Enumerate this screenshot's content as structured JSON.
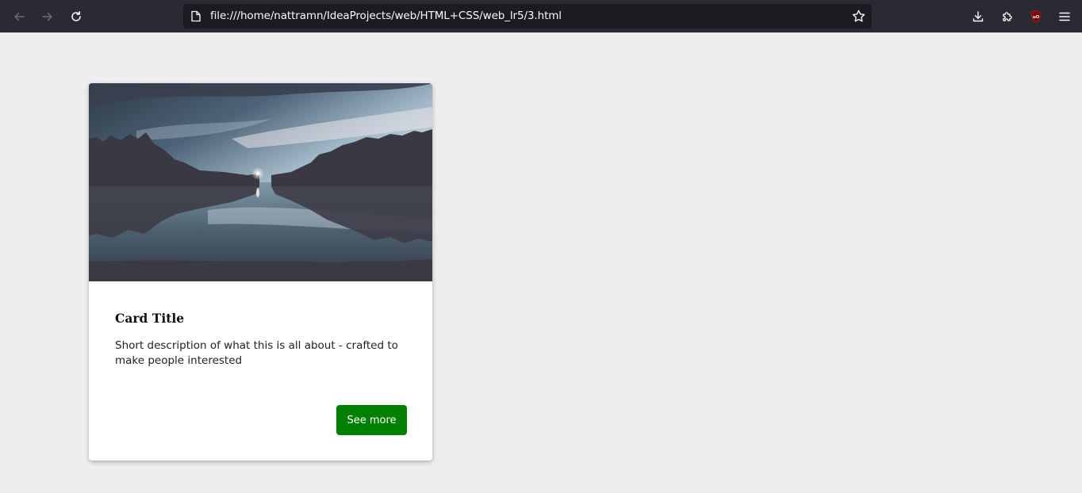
{
  "browser": {
    "url": "file:///home/nattramn/IdeaProjects/web/HTML+CSS/web_lr5/3.html",
    "icons": {
      "back": "arrow-left-icon",
      "forward": "arrow-right-icon",
      "reload": "reload-icon",
      "page": "page-icon",
      "bookmark": "star-icon",
      "downloads": "download-icon",
      "extensions": "puzzle-piece-icon",
      "ublock": "ublock-origin-icon",
      "menu": "hamburger-menu-icon"
    },
    "colors": {
      "toolbar": "#2b2a33",
      "urlbar": "#1c1b22",
      "ublock": "#800000"
    }
  },
  "card": {
    "title": "Card Title",
    "description": "Short description of what this is all about - crafted to make people interested",
    "button_label": "See more",
    "image_alt": "lake-at-dusk-photo",
    "colors": {
      "button": "#008000",
      "background": "#eeeeee"
    }
  }
}
